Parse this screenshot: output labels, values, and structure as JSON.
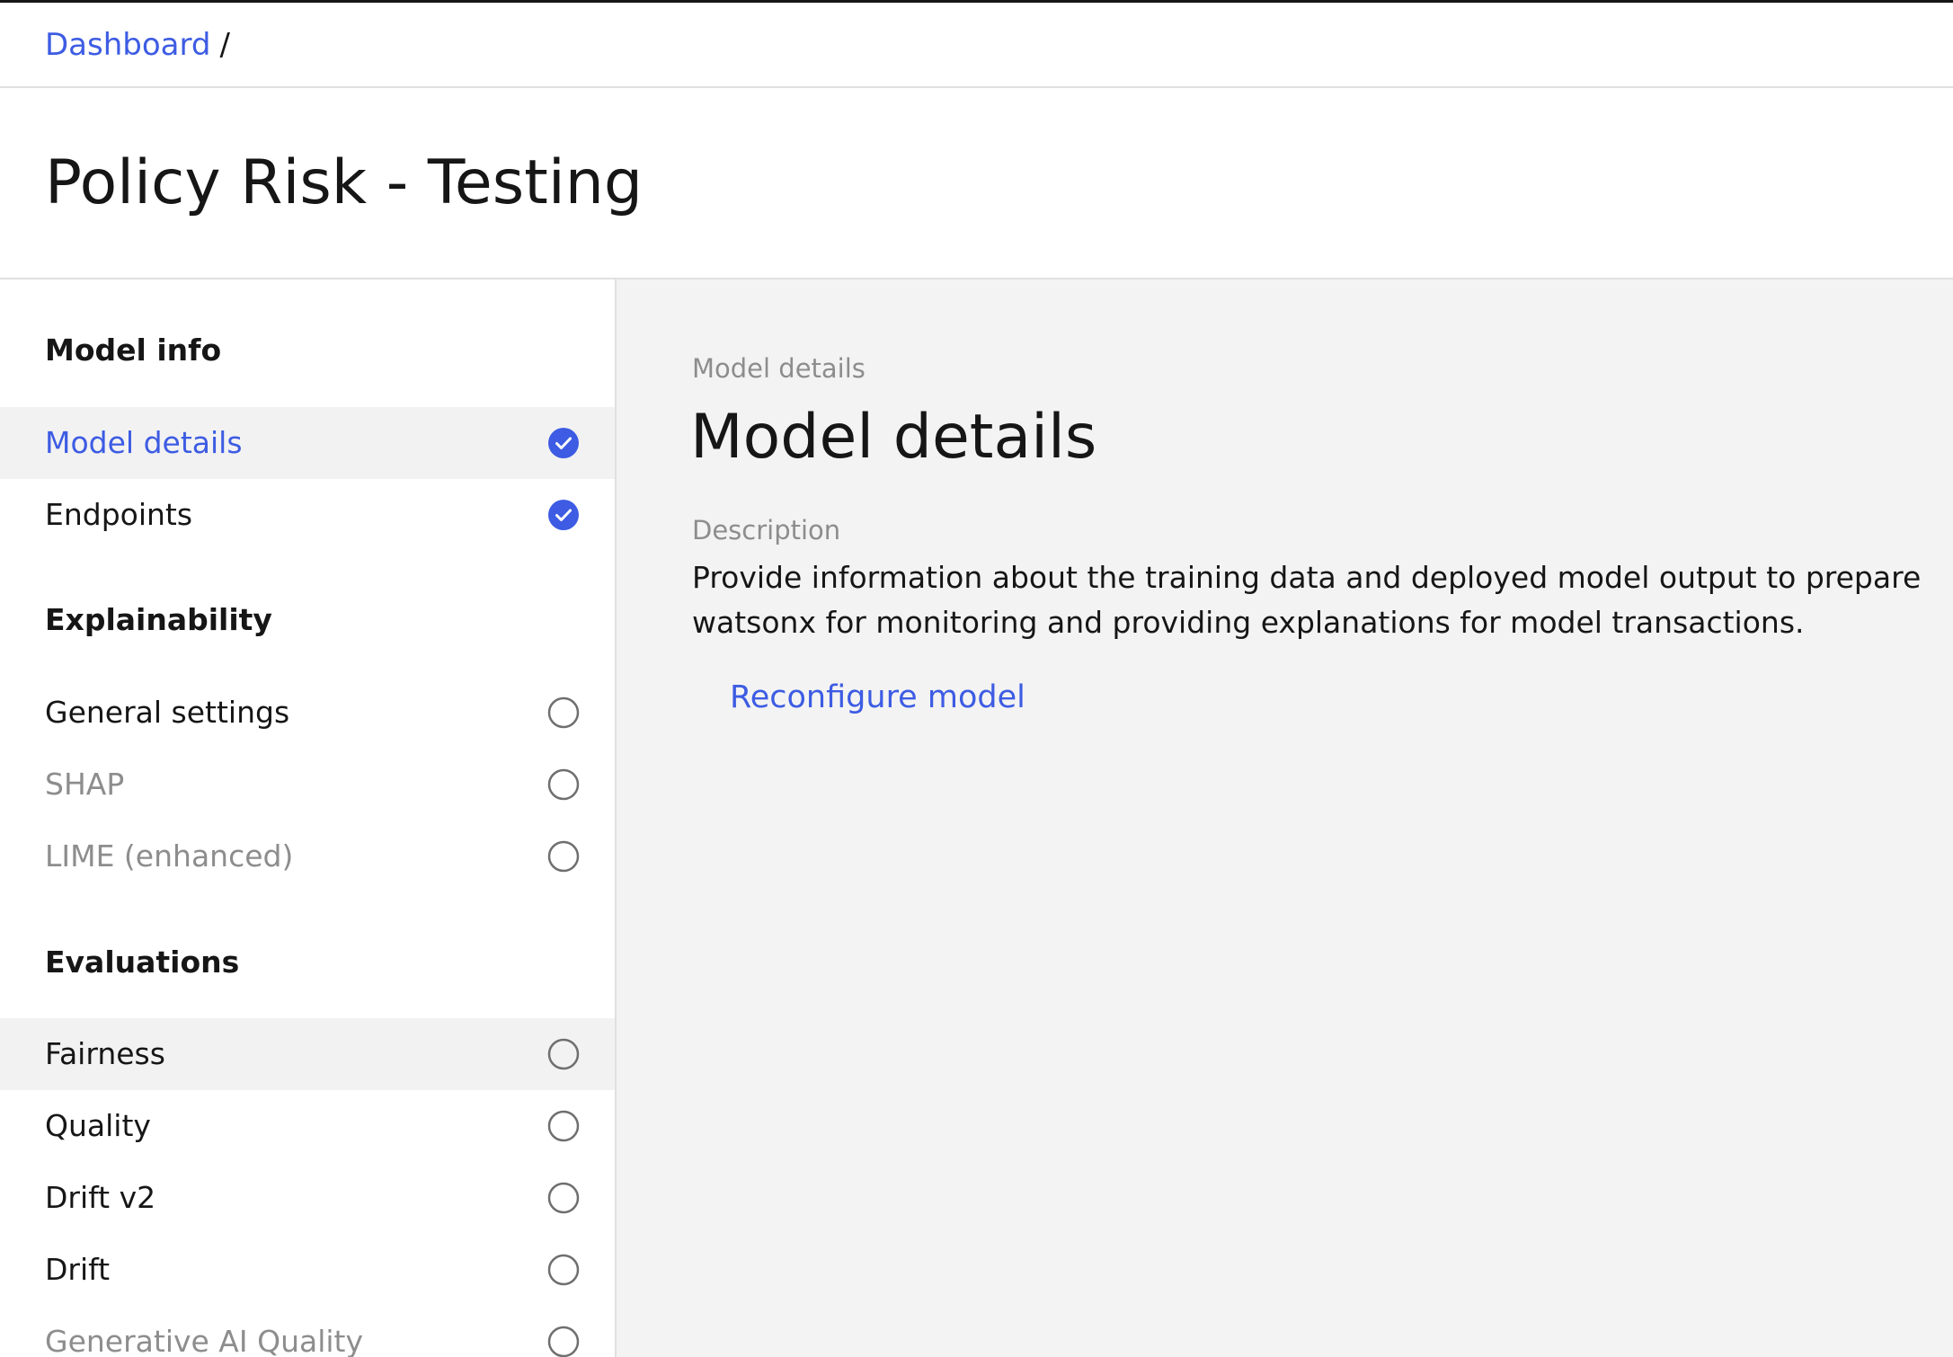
{
  "breadcrumb": {
    "items": [
      "Dashboard"
    ],
    "separator": "/"
  },
  "page": {
    "title": "Policy Risk - Testing"
  },
  "sidebar": {
    "sections": [
      {
        "title": "Model info",
        "items": [
          {
            "label": "Model details",
            "status": "complete",
            "state": "active"
          },
          {
            "label": "Endpoints",
            "status": "complete",
            "state": "normal"
          }
        ]
      },
      {
        "title": "Explainability",
        "items": [
          {
            "label": "General settings",
            "status": "incomplete",
            "state": "normal"
          },
          {
            "label": "SHAP",
            "status": "incomplete",
            "state": "disabled"
          },
          {
            "label": "LIME (enhanced)",
            "status": "incomplete",
            "state": "disabled"
          }
        ]
      },
      {
        "title": "Evaluations",
        "items": [
          {
            "label": "Fairness",
            "status": "incomplete",
            "state": "hover"
          },
          {
            "label": "Quality",
            "status": "incomplete",
            "state": "normal"
          },
          {
            "label": "Drift v2",
            "status": "incomplete",
            "state": "normal"
          },
          {
            "label": "Drift",
            "status": "incomplete",
            "state": "normal"
          },
          {
            "label": "Generative AI Quality",
            "status": "incomplete",
            "state": "disabled"
          }
        ]
      }
    ]
  },
  "main": {
    "eyebrow": "Model details",
    "title": "Model details",
    "description_label": "Description",
    "description": "Provide information about the training data and deployed model output to prepare watsonx for monitoring and providing explanations for model transactions.",
    "reconfigure_label": "Reconfigure model"
  },
  "colors": {
    "accent": "#3d5ce3",
    "text": "#161616",
    "muted": "#8d8d8d",
    "panel_bg": "#f3f3f3",
    "active_bg": "#f2f2f2",
    "border": "#e0e0e0"
  },
  "icons": {
    "complete": "checkmark-filled-icon",
    "incomplete": "circle-outline-icon"
  }
}
